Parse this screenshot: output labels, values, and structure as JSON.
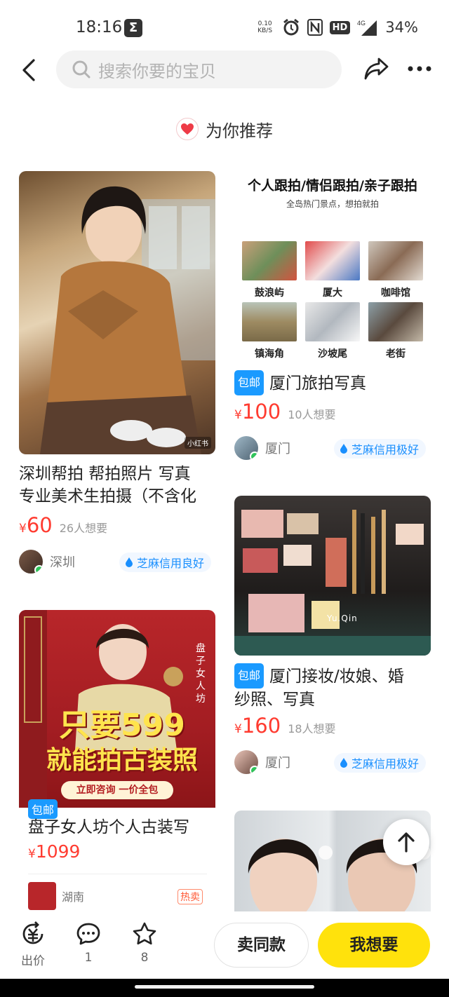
{
  "status_bar": {
    "time": "18:16",
    "net_speed_value": "0.10",
    "net_speed_unit": "KB/S",
    "hd": "HD",
    "network": "4G",
    "battery": "34%"
  },
  "search": {
    "placeholder": "搜索你要的宝贝"
  },
  "recommend": {
    "title": "为你推荐"
  },
  "cards": [
    {
      "title_line1": "深圳帮拍 帮拍照片 写真",
      "title_line2": "专业美术生拍摄（不含化",
      "currency": "¥",
      "price": "60",
      "want": "26人想要",
      "location": "深圳",
      "credit": "芝麻信用良好",
      "image_tag": "小红书"
    },
    {
      "banner_title": "个人跟拍/情侣跟拍/亲子跟拍",
      "banner_sub": "全岛热门景点，想拍就拍",
      "spots": [
        "鼓浪屿",
        "厦大",
        "咖啡馆",
        "镇海角",
        "沙坡尾",
        "老街"
      ],
      "badge": "包邮",
      "title": "厦门旅拍写真",
      "currency": "¥",
      "price": "100",
      "want": "10人想要",
      "location": "厦门",
      "credit": "芝麻信用极好"
    },
    {
      "image_text_line1": "只要599",
      "image_text_line2": "就能拍古装照",
      "image_cta": "立即咨询 一价全包",
      "brand": "盘子女人坊",
      "badge": "包邮",
      "title": "盘子女人坊个人古装写",
      "currency": "¥",
      "price": "1099",
      "location": "湖南",
      "hot": "热卖"
    },
    {
      "badge": "包邮",
      "title_line1": "厦门接妆/妆娘、婚",
      "title_line2": "纱照、写真",
      "currency": "¥",
      "price": "160",
      "want": "18人想要",
      "location": "厦门",
      "credit": "芝麻信用极好",
      "image_text": "Yu.Qin"
    }
  ],
  "bottom_bar": {
    "offer_label": "出价",
    "comment_count": "1",
    "fav_count": "8",
    "same_btn": "卖同款",
    "want_btn": "我想要"
  },
  "colors": {
    "price": "#ff3b30",
    "accent_yellow": "#ffe20c",
    "badge_blue": "#1a9aff",
    "credit_blue": "#1a8ffe"
  }
}
